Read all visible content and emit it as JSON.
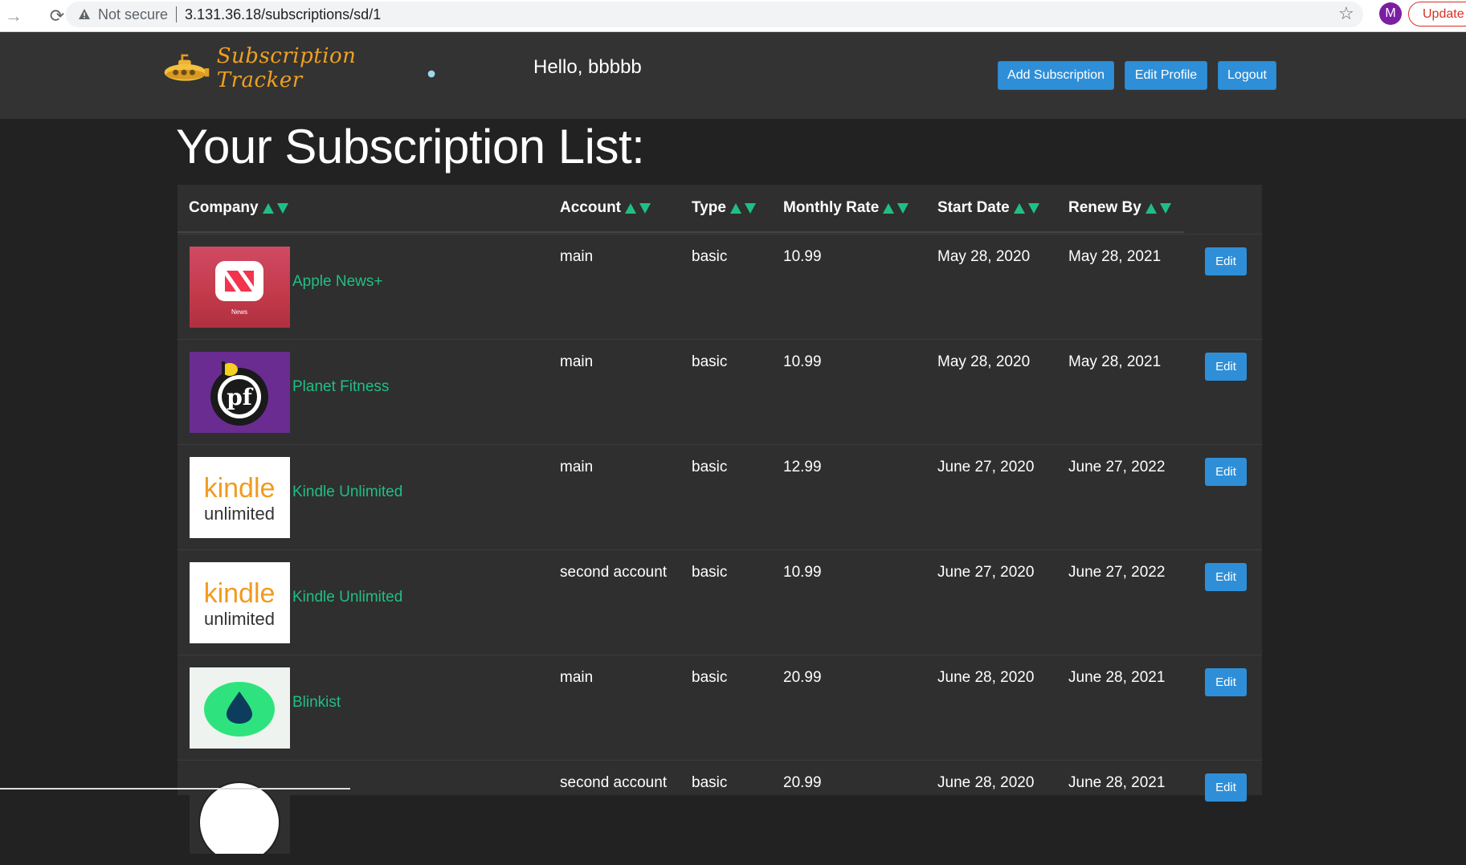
{
  "browser": {
    "not_secure": "Not secure",
    "url": "3.131.36.18/subscriptions/sd/1",
    "avatar_letter": "M",
    "update_label": "Update"
  },
  "nav": {
    "logo_text": "Subscription Tracker",
    "greeting": "Hello, bbbbb",
    "add_subscription": "Add Subscription",
    "edit_profile": "Edit Profile",
    "logout": "Logout"
  },
  "page": {
    "title": "Your Subscription List:"
  },
  "table": {
    "headers": [
      "Company",
      "Account",
      "Type",
      "Monthly Rate",
      "Start Date",
      "Renew By"
    ],
    "edit_label": "Edit",
    "rows": [
      {
        "company": "Apple News+",
        "account": "main",
        "type": "basic",
        "rate": "10.99",
        "start": "May 28, 2020",
        "renew": "May 28, 2021",
        "logo": "apple-news"
      },
      {
        "company": "Planet Fitness",
        "account": "main",
        "type": "basic",
        "rate": "10.99",
        "start": "May 28, 2020",
        "renew": "May 28, 2021",
        "logo": "planet-fitness"
      },
      {
        "company": "Kindle Unlimited",
        "account": "main",
        "type": "basic",
        "rate": "12.99",
        "start": "June 27, 2020",
        "renew": "June 27, 2022",
        "logo": "kindle"
      },
      {
        "company": "Kindle Unlimited",
        "account": "second account",
        "type": "basic",
        "rate": "10.99",
        "start": "June 27, 2020",
        "renew": "June 27, 2022",
        "logo": "kindle"
      },
      {
        "company": "Blinkist",
        "account": "main",
        "type": "basic",
        "rate": "20.99",
        "start": "June 28, 2020",
        "renew": "June 28, 2021",
        "logo": "blinkist"
      },
      {
        "company": "",
        "account": "second account",
        "type": "basic",
        "rate": "20.99",
        "start": "June 28, 2020",
        "renew": "June 28, 2021",
        "logo": "partial"
      }
    ]
  },
  "logos": {
    "apple_news_caption": "News",
    "pf_text": "pf",
    "kindle_word": "kindle",
    "unlimited_word": "unlimited"
  },
  "colors": {
    "accent_green": "#1fbf84",
    "button_blue": "#2e8fd8",
    "navbar_bg": "#333333",
    "page_bg": "#222222",
    "table_bg": "#2f2f2f"
  }
}
